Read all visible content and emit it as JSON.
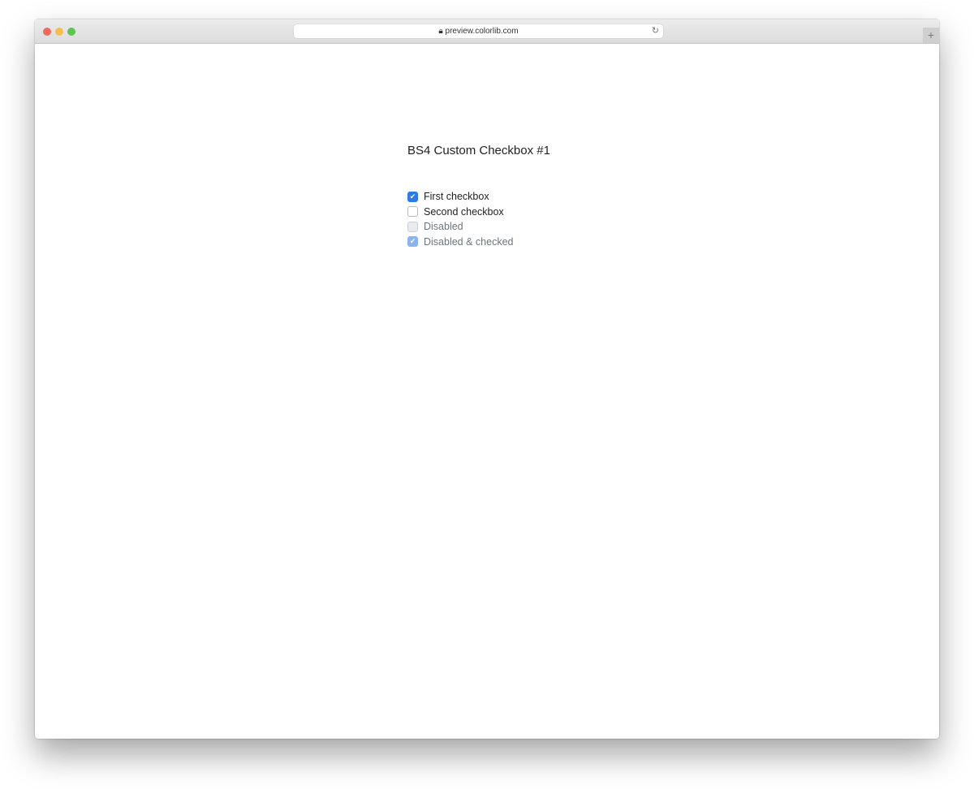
{
  "browser": {
    "url": "preview.colorlib.com",
    "colors": {
      "close": "#ed6a5e",
      "minimize": "#f5bf4f",
      "maximize": "#61c554"
    }
  },
  "page": {
    "title": "BS4 Custom Checkbox #1",
    "checkboxes": [
      {
        "label": "First checkbox",
        "checked": true,
        "disabled": false
      },
      {
        "label": "Second checkbox",
        "checked": false,
        "disabled": false
      },
      {
        "label": "Disabled",
        "checked": false,
        "disabled": true
      },
      {
        "label": "Disabled & checked",
        "checked": true,
        "disabled": true
      }
    ]
  },
  "accent": "#2f7ae5"
}
